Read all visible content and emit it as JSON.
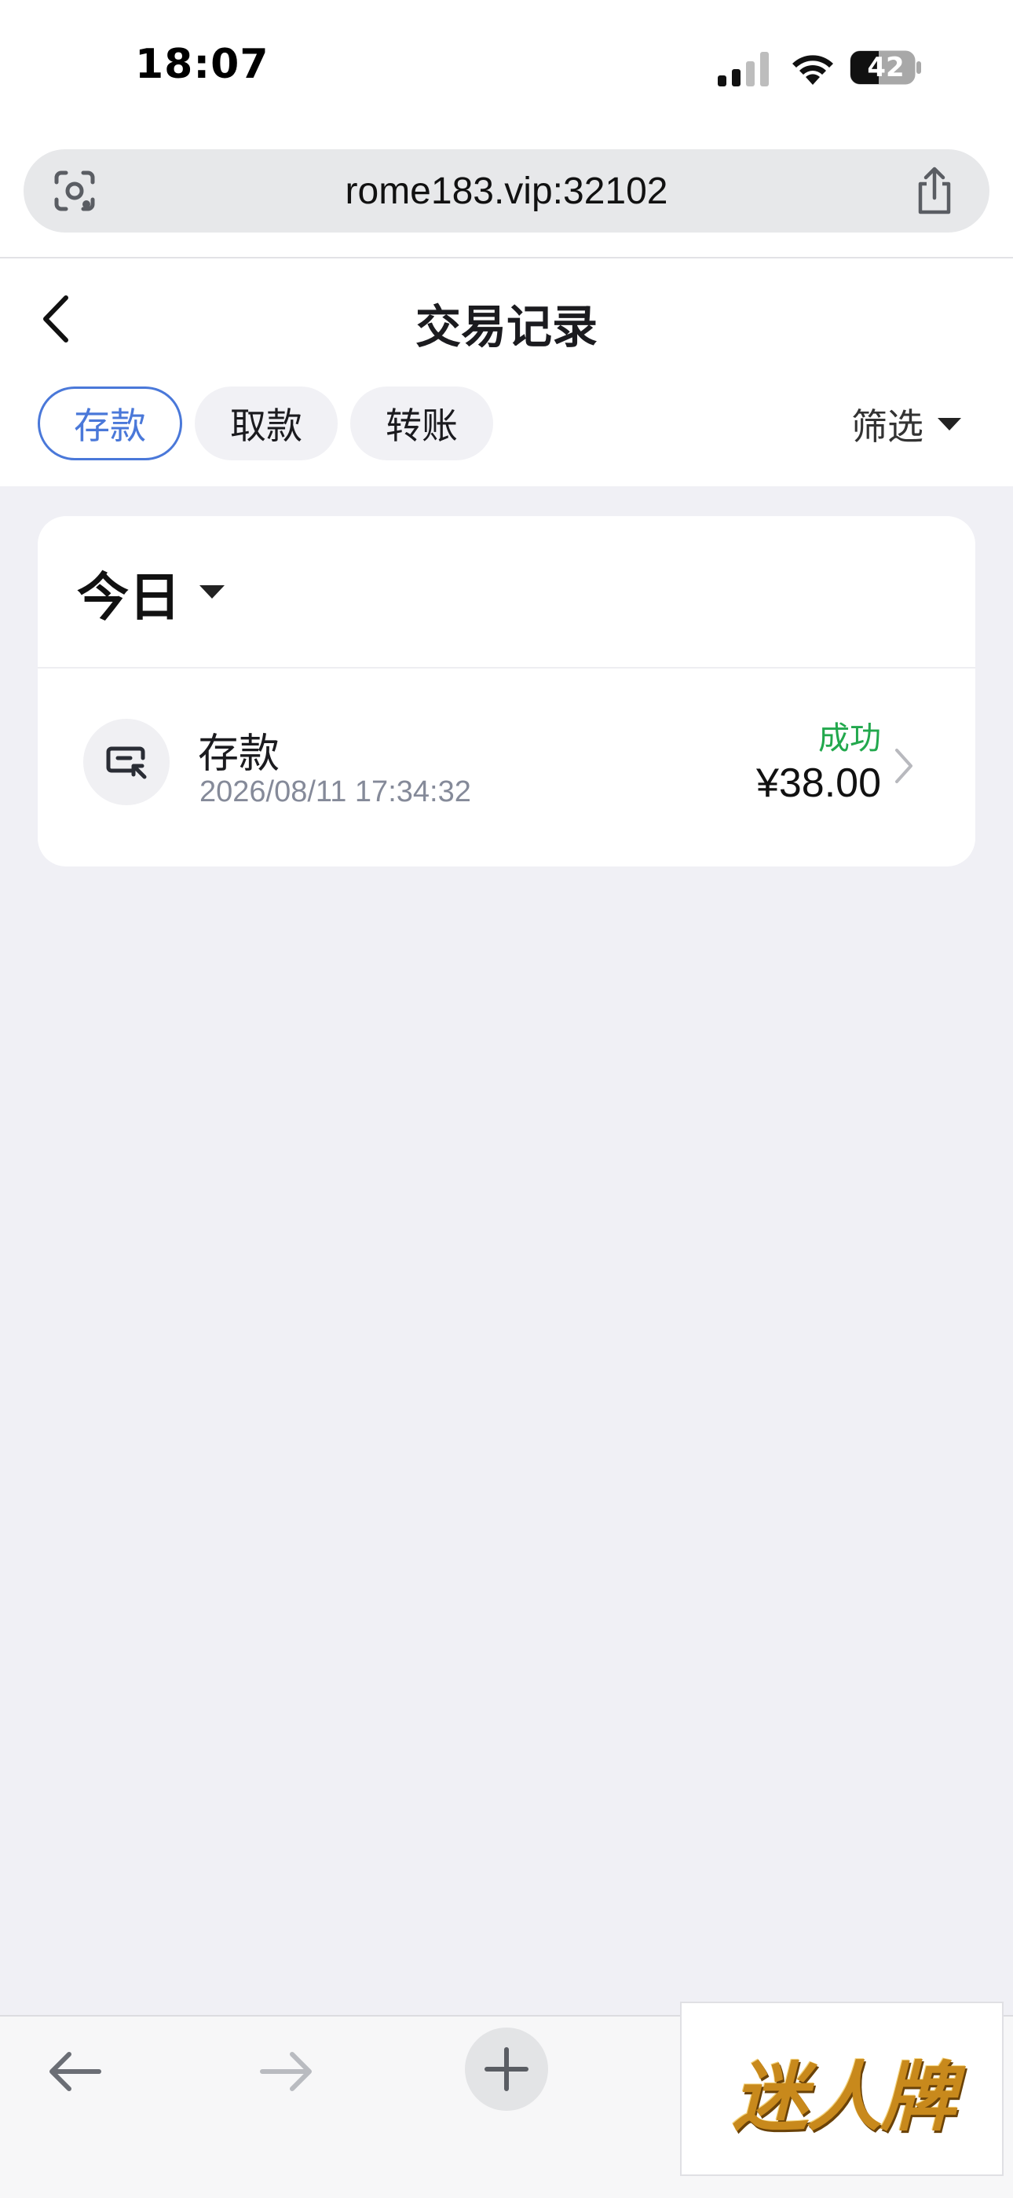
{
  "status_bar": {
    "time": "18:07",
    "battery": "42"
  },
  "browser": {
    "url": "rome183.vip:32102"
  },
  "header": {
    "title": "交易记录",
    "tabs": [
      {
        "label": "存款",
        "active": true
      },
      {
        "label": "取款",
        "active": false
      },
      {
        "label": "转账",
        "active": false
      }
    ],
    "filter_label": "筛选"
  },
  "records": {
    "day_label": "今日",
    "items": [
      {
        "type": "存款",
        "datetime": "2026/08/11 17:34:32",
        "status": "成功",
        "amount": "¥38.00",
        "status_color": "#22a84d"
      }
    ]
  },
  "watermark": {
    "text": "迷人牌"
  },
  "colors": {
    "accent": "#4a78d9",
    "success": "#22a84d",
    "background": "#f0f0f5"
  },
  "icons": [
    "lens-icon",
    "share-icon",
    "back-chevron-icon",
    "deposit-icon",
    "chevron-right-icon",
    "nav-back-icon",
    "nav-forward-icon",
    "plus-icon"
  ]
}
